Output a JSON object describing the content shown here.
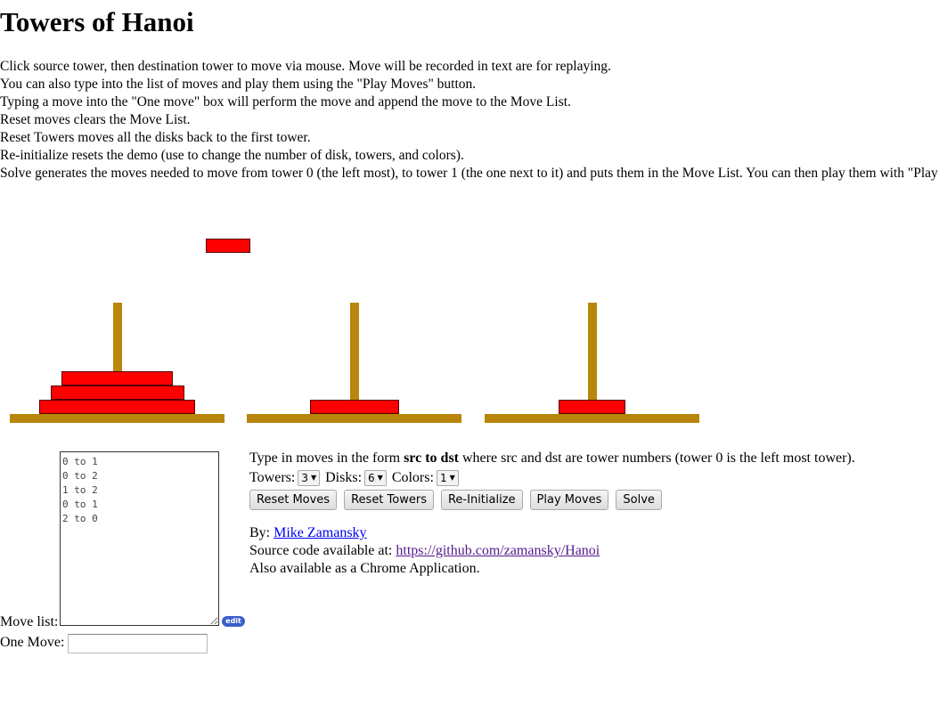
{
  "page": {
    "title": "Towers of Hanoi",
    "intro": [
      "Click source tower, then destination tower to move via mouse. Move will be recorded in text are for replaying.",
      "You can also type into the list of moves and play them using the \"Play Moves\" button.",
      "Typing a move into the \"One move\" box will perform the move and append the move to the Move List.",
      "Reset moves clears the Move List.",
      "Reset Towers moves all the disks back to the first tower.",
      "Re-initialize resets the demo (use to change the number of disk, towers, and colors).",
      "Solve generates the moves needed to move from tower 0 (the left most), to tower 1 (the one next to it) and puts them in the Move List. You can then play them with \"Play Moves\"."
    ]
  },
  "colors": {
    "disk": "#ff0000",
    "tower": "#b8860b",
    "link": "#0000ee",
    "link_visited": "#551a8b"
  },
  "game": {
    "towers": [
      {
        "disks": [
          4,
          5,
          6
        ]
      },
      {
        "disks": [
          3
        ]
      },
      {
        "disks": [
          2
        ]
      }
    ],
    "lifted_disk": 1
  },
  "move_list": {
    "label": "Move list:",
    "moves": [
      "0 to 1",
      "0 to 2",
      "1 to 2",
      "0 to 1",
      "2 to 0"
    ],
    "edit_badge": "edit"
  },
  "one_move": {
    "label": "One Move:",
    "value": ""
  },
  "instructions": {
    "prefix": "Type in moves in the form ",
    "form": "src to dst",
    "suffix": " where src and dst are tower numbers (tower 0 is the left most tower)."
  },
  "options": {
    "towers_label": "Towers:",
    "towers_value": "3",
    "disks_label": "Disks:",
    "disks_value": "6",
    "colors_label": "Colors:",
    "colors_value": "1"
  },
  "buttons": {
    "reset_moves": "Reset Moves",
    "reset_towers": "Reset Towers",
    "reinitialize": "Re-Initialize",
    "play_moves": "Play Moves",
    "solve": "Solve"
  },
  "credits": {
    "by_label": "By: ",
    "author": "Mike Zamansky",
    "source_label": "Source code available at: ",
    "source_url": "https://github.com/zamansky/Hanoi",
    "chrome_text": "Also available as a Chrome Application."
  }
}
